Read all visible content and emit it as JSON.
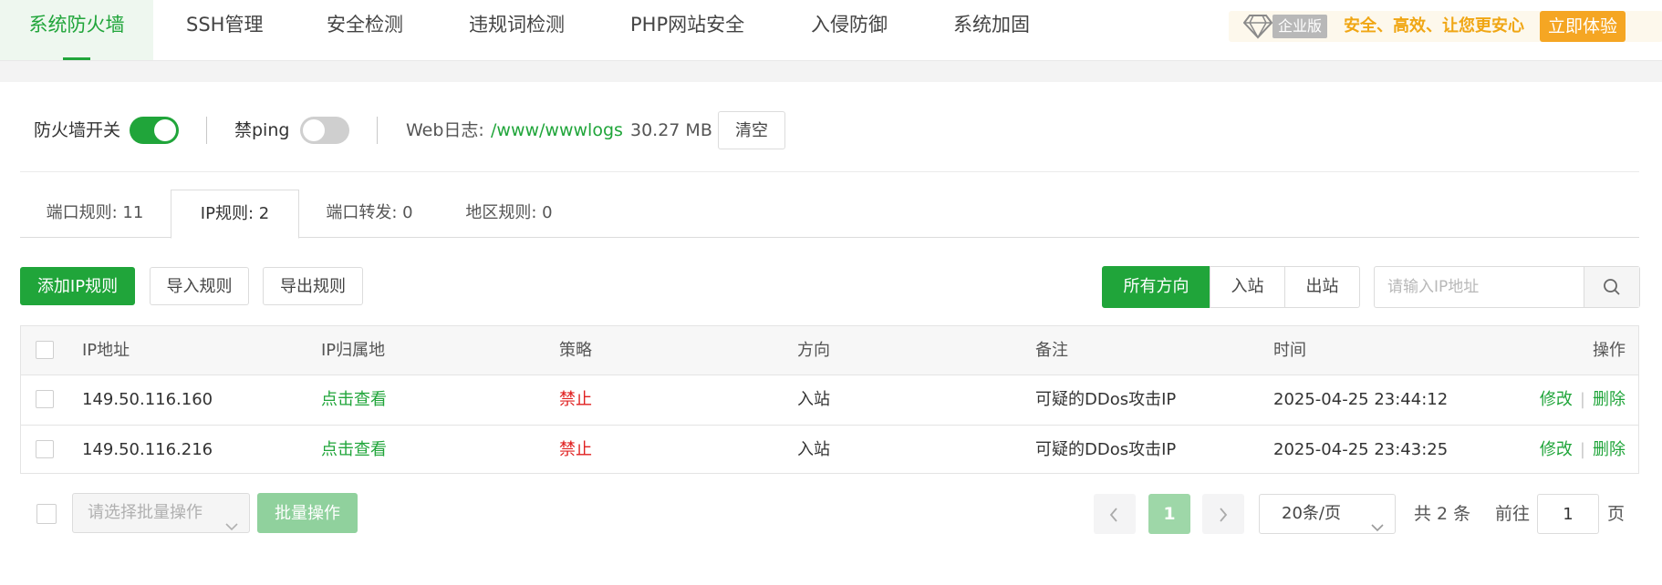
{
  "nav": {
    "tabs": [
      {
        "label": "系统防火墙",
        "active": true
      },
      {
        "label": "SSH管理"
      },
      {
        "label": "安全检测"
      },
      {
        "label": "违规词检测"
      },
      {
        "label": "PHP网站安全"
      },
      {
        "label": "入侵防御"
      },
      {
        "label": "系统加固"
      }
    ],
    "promo": {
      "badge": "企业版",
      "text": "安全、高效、让您更安心",
      "button": "立即体验"
    }
  },
  "toolbar": {
    "firewall_label": "防火墙开关",
    "firewall_on": true,
    "ping_label": "禁ping",
    "ping_on": false,
    "weblog_label": "Web日志:",
    "weblog_path": "/www/wwwlogs",
    "weblog_size": "30.27 MB",
    "clear_button": "清空"
  },
  "subtabs": [
    {
      "label": "端口规则: 11"
    },
    {
      "label": "IP规则: 2",
      "active": true
    },
    {
      "label": "端口转发: 0"
    },
    {
      "label": "地区规则: 0"
    }
  ],
  "actions": {
    "add": "添加IP规则",
    "import": "导入规则",
    "export": "导出规则",
    "directions": [
      "所有方向",
      "入站",
      "出站"
    ],
    "search_placeholder": "请输入IP地址"
  },
  "table": {
    "columns": [
      "IP地址",
      "IP归属地",
      "策略",
      "方向",
      "备注",
      "时间",
      "操作"
    ],
    "rows": [
      {
        "ip": "149.50.116.160",
        "location": "点击查看",
        "policy": "禁止",
        "direction": "入站",
        "remark": "可疑的DDos攻击IP",
        "time": "2025-04-25 23:44:12",
        "edit": "修改",
        "delete": "删除"
      },
      {
        "ip": "149.50.116.216",
        "location": "点击查看",
        "policy": "禁止",
        "direction": "入站",
        "remark": "可疑的DDos攻击IP",
        "time": "2025-04-25 23:43:25",
        "edit": "修改",
        "delete": "删除"
      }
    ]
  },
  "footer": {
    "batch_placeholder": "请选择批量操作",
    "batch_button": "批量操作",
    "current_page": "1",
    "page_size": "20条/页",
    "total": "共 2 条",
    "goto_label": "前往",
    "goto_value": "1",
    "page_unit": "页"
  },
  "colors": {
    "accent": "#20a53a",
    "danger": "#e02020",
    "promo": "#f0a614"
  },
  "icons": {
    "promo": "diamond-icon",
    "search": "search-icon",
    "prev": "chevron-left-icon",
    "next": "chevron-right-icon",
    "dropdown": "chevron-down-icon"
  }
}
